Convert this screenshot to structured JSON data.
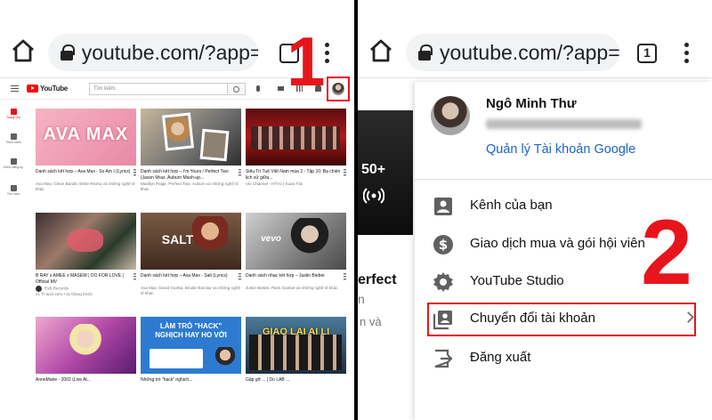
{
  "left": {
    "url": "youtube.com/?app=",
    "tab_count": "",
    "step": "1",
    "yt_logo": "YouTube",
    "search_placeholder": "Tìm kiếm",
    "side_nav": [
      {
        "label": "Trang chủ",
        "active": true
      },
      {
        "label": "Thịnh hành",
        "active": false
      },
      {
        "label": "Kênh đăng ký",
        "active": false
      },
      {
        "label": "Thư viện",
        "active": false
      }
    ],
    "videos": [
      {
        "thumb_text": "AVA MAX",
        "title": "Danh sách kết hợp – Ava Max - So Am I (Lyrics)",
        "meta1": "Ava Max, Clean Bandit, Bebe Rexha và những nghệ sĩ khác",
        "meta2": ""
      },
      {
        "thumb_text": "",
        "title": "Danh sách kết hợp – I'm Yours / Perfect Two (Jason Mraz, Auburn Mash-up...",
        "meta1": "Madilyn Paige, Perfect Two, Auburn và những nghệ sĩ khác",
        "meta2": ""
      },
      {
        "thumb_text": "",
        "title": "Siêu Trí Tuệ Việt Nam mùa 2 - Tập 10: Bạ chiến lịch sử giữa...",
        "meta1": "Vie Channel - HTV2 | Kuan Tân",
        "meta2": ""
      },
      {
        "thumb_text": "",
        "title": "B RAY x AMEE x MASEW | DO FOR LOVE | Official MV",
        "meta1": "EvB Records",
        "meta2": "21 Tr lượt xem • 11 tháng trước"
      },
      {
        "thumb_text": "SALT",
        "title": "Danh sách kết hợp – Ava Max - Salt (Lyrics)",
        "meta1": "Ava Max, David Guetta, Brodie Barclay và những nghệ sĩ khác",
        "meta2": ""
      },
      {
        "thumb_text": "vevo",
        "title": "Danh sách nhạc kết hợp – Justin Bieber",
        "meta1": "Justin Bieber, Paris Goebel và những nghệ sĩ khác",
        "meta2": ""
      },
      {
        "thumb_text": "",
        "title": "AnneMarie - 2002 (Live At...",
        "meta1": "",
        "meta2": ""
      },
      {
        "thumb_text": "LÀM TRÒ \"HACK\" NGHỊCH HAY HO VỚI",
        "title": "Những trò \"hack\" nghịch...",
        "meta1": "",
        "meta2": ""
      },
      {
        "thumb_text": "GIAO LAI AI LI",
        "title": "Gặp gỡ ... | Do LAB ...",
        "meta1": "",
        "meta2": ""
      }
    ]
  },
  "right": {
    "url": "youtube.com/?app=",
    "tab_count": "1",
    "step": "2",
    "bg": {
      "views": "50+",
      "title_fragment": "erfect",
      "line2": "n",
      "line3": "n và"
    },
    "account": {
      "name": "Ngô Minh Thư",
      "manage_link": "Quản lý Tài khoản Google"
    },
    "menu": [
      {
        "label": "Kênh của bạn",
        "icon": "person-box-icon"
      },
      {
        "label": "Giao dịch mua và gói hội viên",
        "icon": "dollar-circle-icon"
      },
      {
        "label": "YouTube Studio",
        "icon": "gear-icon"
      },
      {
        "label": "Chuyển đổi tài khoản",
        "icon": "switch-account-icon"
      },
      {
        "label": "Đăng xuất",
        "icon": "sign-out-icon"
      }
    ]
  },
  "colors": {
    "highlight": "#e8141c",
    "link": "#1a64c9"
  }
}
